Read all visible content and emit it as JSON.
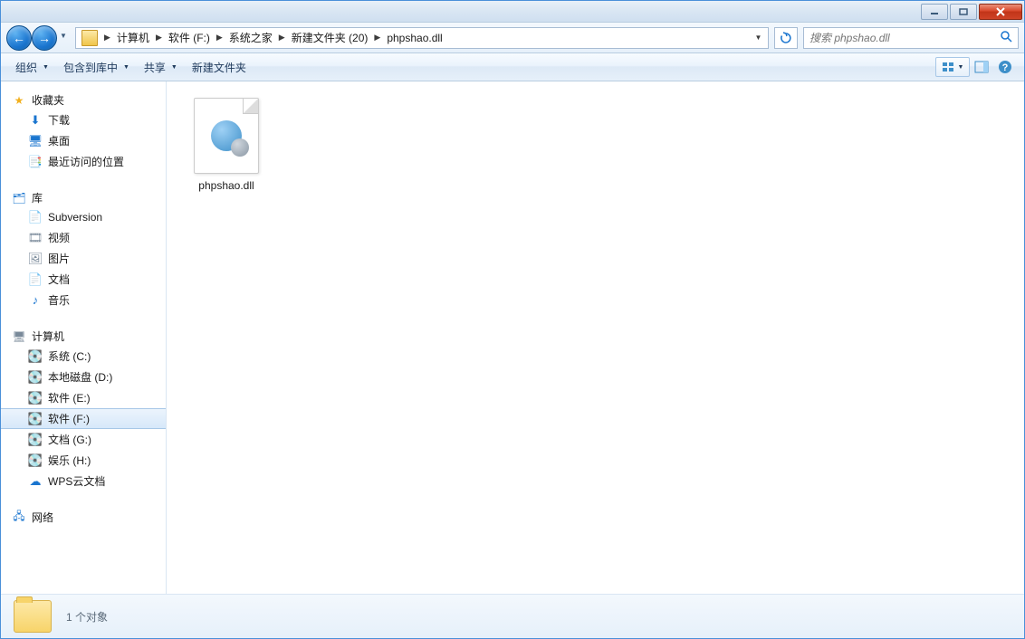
{
  "breadcrumb": [
    "计算机",
    "软件 (F:)",
    "系统之家",
    "新建文件夹 (20)",
    "phpshao.dll"
  ],
  "search": {
    "placeholder": "搜索 phpshao.dll"
  },
  "toolbar": {
    "organize": "组织",
    "include": "包含到库中",
    "share": "共享",
    "newfolder": "新建文件夹"
  },
  "sidebar": {
    "favorites": {
      "label": "收藏夹",
      "items": [
        "下载",
        "桌面",
        "最近访问的位置"
      ]
    },
    "libraries": {
      "label": "库",
      "items": [
        "Subversion",
        "视频",
        "图片",
        "文档",
        "音乐"
      ]
    },
    "computer": {
      "label": "计算机",
      "items": [
        "系统 (C:)",
        "本地磁盘 (D:)",
        "软件 (E:)",
        "软件 (F:)",
        "文档 (G:)",
        "娱乐 (H:)",
        "WPS云文档"
      ],
      "selected": 3
    },
    "network": {
      "label": "网络"
    }
  },
  "files": [
    {
      "name": "phpshao.dll"
    }
  ],
  "status": {
    "text": "1 个对象"
  }
}
